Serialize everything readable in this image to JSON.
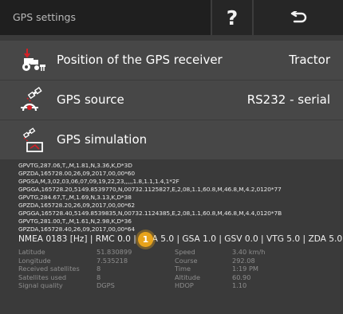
{
  "header": {
    "title": "GPS settings",
    "help_label": "?",
    "help_icon": "question-icon",
    "back_icon": "return-arrow-icon"
  },
  "menu": [
    {
      "label": "Position of the GPS receiver",
      "value": "Tractor",
      "icon": "tractor-receiver-icon"
    },
    {
      "label": "GPS source",
      "value": "RS232 - serial",
      "icon": "satellite-source-icon"
    },
    {
      "label": "GPS simulation",
      "value": "",
      "icon": "gps-simulation-icon"
    }
  ],
  "nmea_lines": [
    "GPVTG,287.06,T,,M,1.81,N,3.36,K,D*3D",
    "GPZDA,165728.00,26,09,2017,00,00*60",
    "GPGSA,M,3,02,03,06,07,09,19,22,23,,,,,1.8,1.1,1.4,1*2F",
    "GPGGA,165728.20,5149.8539770,N,00732.1125827,E,2,08,1.1,60.8,M,46.8,M,4.2,0120*77",
    "GPVTG,284.67,T,,M,1.69,N,3.13,K,D*38",
    "GPZDA,165728.20,26,09,2017,00,00*62",
    "GPGGA,165728.40,5149.8539835,N,00732.1124385,E,2,08,1.1,60.8,M,46.8,M,4.4,0120*7B",
    "GPVTG,281.00,T,,M,1.61,N,2.98,K,D*36",
    "GPZDA,165728.40,26,09,2017,00,00*64"
  ],
  "rates": {
    "text": "NMEA 0183 [Hz] | RMC 0.0 | GGA 5.0 | GSA 1.0 | GSV 0.0 | VTG 5.0 | ZDA 5.0",
    "badge": "1"
  },
  "info": {
    "left_labels": [
      "Latitude",
      "Longitude",
      "Received satellites",
      "Satellites used",
      "Signal quality"
    ],
    "left_values": [
      "51.830899",
      "7.535218",
      "8",
      "8",
      "DGPS"
    ],
    "right_labels": [
      "Speed",
      "Course",
      "Time",
      "Altitude",
      "HDOP"
    ],
    "right_values": [
      "3.40 km/h",
      "292.08",
      "1:19 PM",
      "60.90",
      "1.10"
    ]
  },
  "colors": {
    "header_bg": "#1f1f1f",
    "row_bg": "#474747",
    "panel_bg": "#3a3a3a",
    "accent_red": "#d61f26",
    "badge": "#e8a31b"
  }
}
